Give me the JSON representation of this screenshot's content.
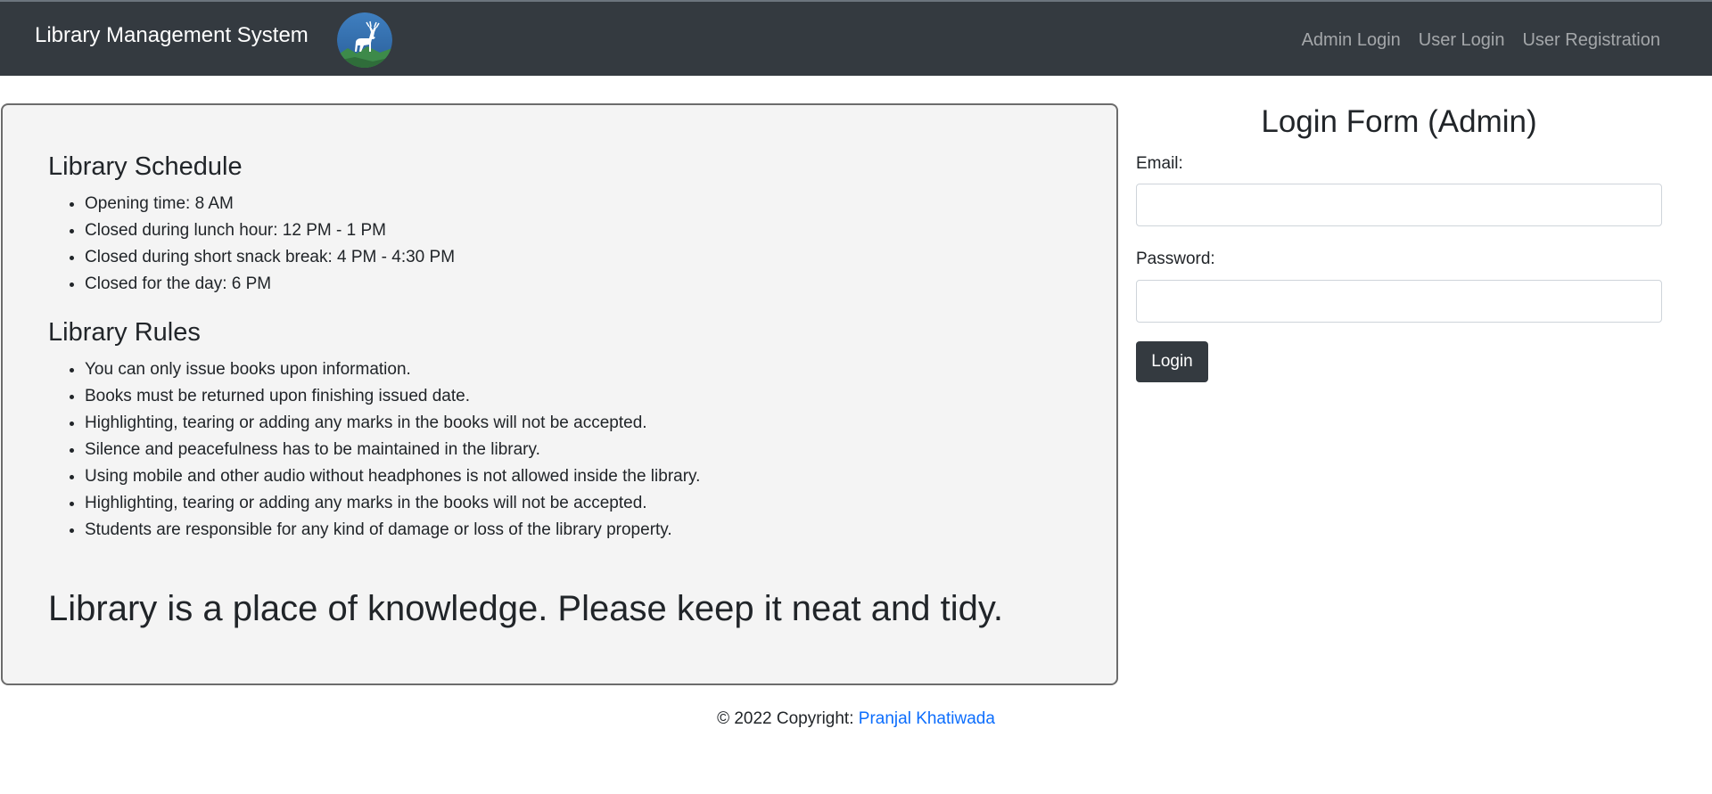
{
  "navbar": {
    "brand": "Library Management System",
    "logo_icon": "deer-logo-icon",
    "links": [
      {
        "label": "Admin Login"
      },
      {
        "label": "User Login"
      },
      {
        "label": "User Registration"
      }
    ]
  },
  "info": {
    "schedule_heading": "Library Schedule",
    "schedule_items": [
      "Opening time: 8 AM",
      "Closed during lunch hour: 12 PM - 1 PM",
      "Closed during short snack break: 4 PM - 4:30 PM",
      "Closed for the day: 6 PM"
    ],
    "rules_heading": "Library Rules",
    "rules_items": [
      "You can only issue books upon information.",
      "Books must be returned upon finishing issued date.",
      "Highlighting, tearing or adding any marks in the books will not be accepted.",
      "Silence and peacefulness has to be maintained in the library.",
      "Using mobile and other audio without headphones is not allowed inside the library.",
      "Highlighting, tearing or adding any marks in the books will not be accepted.",
      "Students are responsible for any kind of damage or loss of the library property."
    ],
    "tagline": "Library is a place of knowledge. Please keep it neat and tidy."
  },
  "login": {
    "title": "Login Form (Admin)",
    "email_label": "Email:",
    "email_value": "",
    "password_label": "Password:",
    "password_value": "",
    "button_label": "Login"
  },
  "footer": {
    "prefix": "© 2022 Copyright: ",
    "author": "Pranjal Khatiwada"
  },
  "colors": {
    "navbar_bg": "#343a40",
    "panel_bg": "#f4f4f4",
    "link": "#0d6efd",
    "button_bg": "#343a40"
  }
}
